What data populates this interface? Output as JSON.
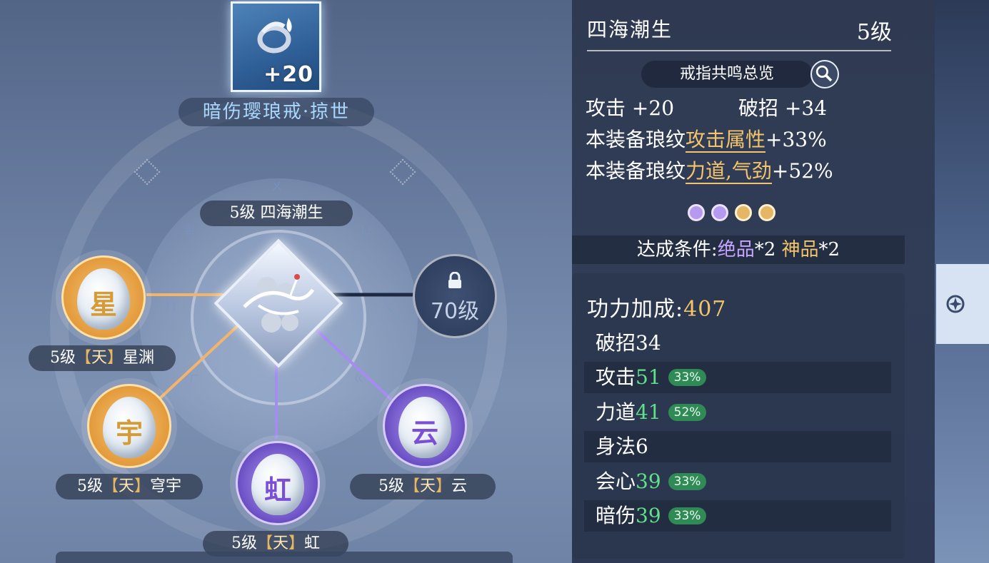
{
  "equipment": {
    "enhance_level": "+20",
    "name": "暗伤璎琅戒·掠世",
    "icon": "ring-icon"
  },
  "core": {
    "label": "5级 四海潮生",
    "icon": "crane-emblem-icon"
  },
  "slots": [
    {
      "level": "5级",
      "tier": "天",
      "name": "星渊",
      "glyph": "星",
      "color": "gold"
    },
    {
      "level": "5级",
      "tier": "天",
      "name": "穹宇",
      "glyph": "宇",
      "color": "gold"
    },
    {
      "level": "5级",
      "tier": "天",
      "name": "虹",
      "glyph": "虹",
      "color": "purple"
    },
    {
      "level": "5级",
      "tier": "天",
      "name": "云",
      "glyph": "云",
      "color": "purple"
    }
  ],
  "locked_slot": {
    "text": "70级",
    "icon": "lock-icon"
  },
  "panel": {
    "title": "四海潮生",
    "level": "5级",
    "overview_label": "戒指共鸣总览",
    "overview_icon": "magnifier-icon",
    "attack": {
      "label": "攻击",
      "value": "+20"
    },
    "pierce": {
      "label": "破招",
      "value": "+34"
    },
    "line1": {
      "prefix": "本装备琅纹",
      "highlight": "攻击属性",
      "value": "+33%"
    },
    "line2": {
      "prefix": "本装备琅纹",
      "highlight": "力道,气劲",
      "value": "+52%"
    },
    "gems": [
      "#b69af0",
      "#b69af0",
      "#e5b663",
      "#e5b663"
    ],
    "condition": {
      "prefix": "达成条件:",
      "a_name": "绝品",
      "a_count": "*2",
      "b_name": "神品",
      "b_count": "*2"
    },
    "power": {
      "label": "功力加成:",
      "value": "407"
    },
    "stats": [
      {
        "label": "破招",
        "value": "34",
        "pct": ""
      },
      {
        "label": "攻击",
        "value": "51",
        "pct": "33%"
      },
      {
        "label": "力道",
        "value": "41",
        "pct": "52%"
      },
      {
        "label": "身法",
        "value": "6",
        "pct": ""
      },
      {
        "label": "会心",
        "value": "39",
        "pct": "33%"
      },
      {
        "label": "暗伤",
        "value": "39",
        "pct": "33%"
      }
    ]
  },
  "side": {
    "icon": "compass-icon"
  },
  "colors": {
    "gold": "#f3c46b",
    "green": "#5fe08a",
    "purple": "#c7a6ff",
    "badge": "#2f8a56"
  }
}
